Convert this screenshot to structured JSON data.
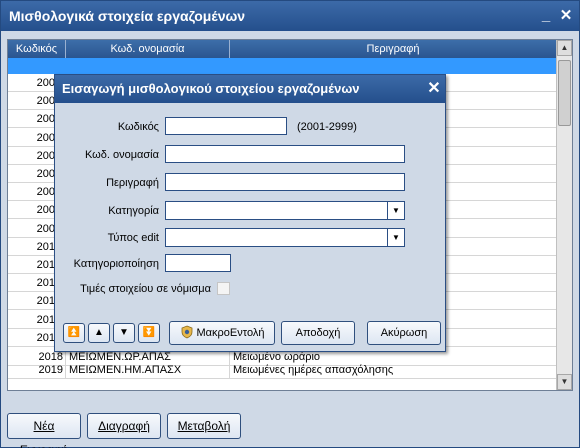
{
  "window": {
    "title": "Μισθολογικά στοιχεία εργαζομένων",
    "min_glyph": "_",
    "close_glyph": "✕"
  },
  "grid": {
    "columns": [
      "Κωδικός",
      "Κωδ. ονομασία",
      "Περιγραφή"
    ],
    "hidden_row_code_prefixes": [
      "200",
      "200",
      "200",
      "200",
      "200",
      "200",
      "200",
      "200",
      "200",
      "201",
      "201",
      "201",
      "201",
      "201",
      "201"
    ],
    "rows": [
      {
        "code": "2018",
        "short": "ΜΕΙΩΜΕΝ.ΩΡ.ΑΠΑΣ",
        "desc": "Μειωμένο ωράριο"
      },
      {
        "code": "2019",
        "short": "ΜΕΙΩΜΕΝ.ΗΜ.ΑΠΑΣΧ",
        "desc": "Μειωμένες ημέρες απασχόλησης"
      }
    ]
  },
  "buttons": {
    "new": "Νέα Εγγραφή",
    "delete": "Διαγραφή",
    "modify": "Μεταβολή"
  },
  "dialog": {
    "title": "Εισαγωγή μισθολογικού στοιχείου εργαζομένων",
    "close_glyph": "✕",
    "fields": {
      "code_label": "Κωδικός",
      "code_value": "",
      "code_hint": "(2001-2999)",
      "short_label": "Κωδ. ονομασία",
      "short_value": "",
      "desc_label": "Περιγραφή",
      "desc_value": "",
      "category_label": "Κατηγορία",
      "category_value": "",
      "edit_type_label": "Τύπος edit",
      "edit_type_value": "",
      "classification_label": "Κατηγοριοποίηση",
      "classification_value": "",
      "currency_label": "Τιμές στοιχείου σε νόμισμα"
    },
    "nav": {
      "first_glyph": "⏫",
      "prev_glyph": "▲",
      "next_glyph": "▼",
      "last_glyph": "⏬"
    },
    "actions": {
      "macro": "ΜακροΕντολή",
      "accept": "Αποδοχή",
      "cancel": "Ακύρωση"
    }
  },
  "colors": {
    "title_bar": "#2f5d9a",
    "selected_row": "#3399ff",
    "window_bg": "#cfd9e6"
  },
  "icons": {
    "macro": "shield-gear-icon",
    "dropdown": "chevron-down-icon"
  }
}
